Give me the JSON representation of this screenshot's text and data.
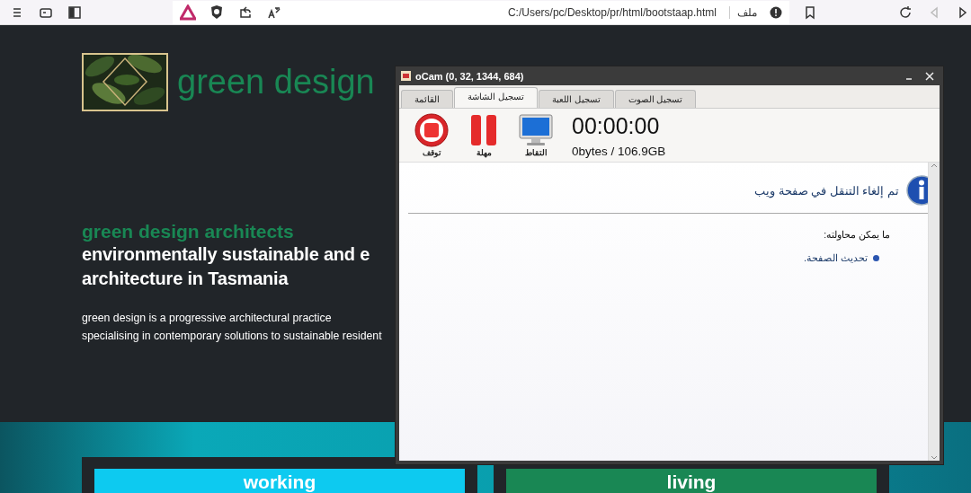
{
  "browser": {
    "url": "C:/Users/pc/Desktop/pr/html/bootstaap.html",
    "scheme_label": "ملف"
  },
  "page": {
    "brand": "green design",
    "kicker": "green design architects",
    "headline": [
      "environmentally sustainable and e",
      "architecture in Tasmania"
    ],
    "intro": [
      "green design is a progressive architectural practice",
      "specialising in contemporary solutions to sustainable resident"
    ],
    "left_card": {
      "label": "working",
      "color": "#0dcaf0"
    },
    "right_card": {
      "label": "living",
      "color": "#198754"
    }
  },
  "ocam": {
    "title": "oCam (0, 32, 1344, 684)",
    "tabs": [
      {
        "label": "تسجيل الصوت",
        "selected": false
      },
      {
        "label": "تسجيل اللعبة",
        "selected": false
      },
      {
        "label": "تسجيل الشاشة",
        "selected": true
      },
      {
        "label": "القائمة",
        "selected": false
      }
    ],
    "actions": [
      {
        "kind": "capture",
        "label": "التقاط"
      },
      {
        "kind": "pause",
        "label": "مهلة"
      },
      {
        "kind": "stop",
        "label": "توقف"
      }
    ],
    "timer": "00:00:00",
    "storage": "0bytes / 106.9GB",
    "notice": {
      "title": "تم إلغاء التنقل في صفحة ويب",
      "prompt": "ما يمكن محاولته:",
      "suggestions": [
        "تحديث الصفحة."
      ]
    }
  }
}
